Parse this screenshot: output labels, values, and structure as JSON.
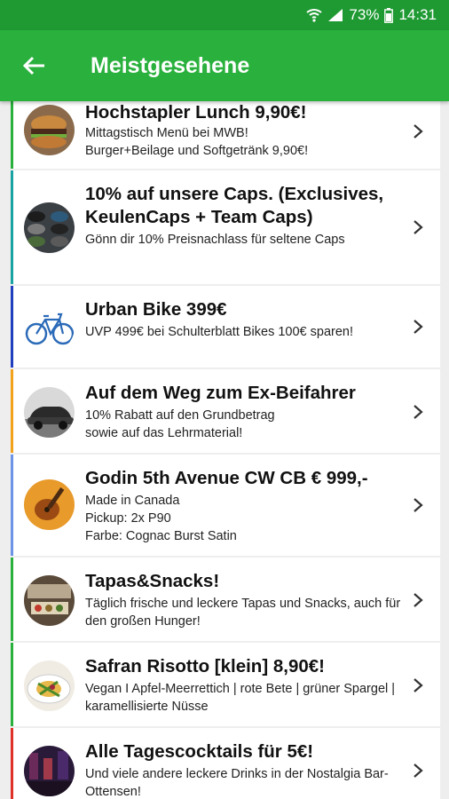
{
  "status": {
    "battery": "73%",
    "time": "14:31"
  },
  "header": {
    "title": "Meistgesehene"
  },
  "items": [
    {
      "title": "Hochstapler Lunch 9,90€!",
      "desc": "Mittagstisch Menü bei MWB!\nBurger+Beilage und Softgetränk 9,90€!",
      "accent": "#2ab13d"
    },
    {
      "title": "10% auf unsere Caps. (Exclusives, KeulenCaps + Team Caps)",
      "desc": "Gönn dir 10% Preisnachlass für seltene Caps",
      "accent": "#1aa3a3"
    },
    {
      "title": "Urban Bike 399€",
      "desc": "UVP 499€ bei Schulterblatt Bikes 100€ sparen!",
      "accent": "#1f3fbf"
    },
    {
      "title": "Auf dem Weg zum Ex-Beifahrer",
      "desc": "10% Rabatt auf den Grundbetrag\nsowie auf das Lehrmaterial!",
      "accent": "#f3a21c"
    },
    {
      "title": "Godin 5th Avenue CW CB € 999,-",
      "desc": "Made in Canada\nPickup: 2x P90\nFarbe: Cognac Burst Satin",
      "accent": "#6b93e6"
    },
    {
      "title": "Tapas&Snacks!",
      "desc": "Täglich frische und leckere Tapas und Snacks, auch für den großen Hunger!",
      "accent": "#2ab13d"
    },
    {
      "title": "Safran Risotto [klein] 8,90€!",
      "desc": "Vegan I Apfel-Meerrettich | rote Bete | grüner Spargel | karamellisierte Nüsse",
      "accent": "#2ab13d"
    },
    {
      "title": "Alle Tagescocktails für 5€!",
      "desc": "Und viele andere leckere Drinks in der Nostalgia Bar-Ottensen!",
      "accent": "#e0302a"
    }
  ]
}
